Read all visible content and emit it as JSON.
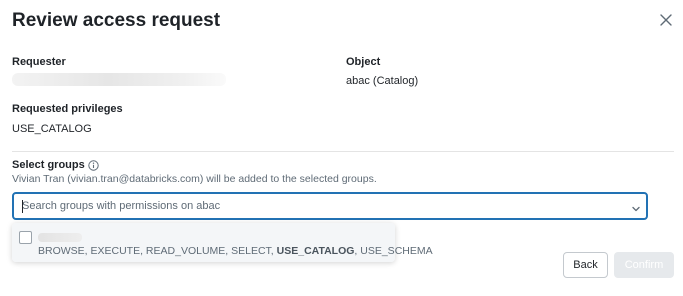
{
  "dialog": {
    "title": "Review access request"
  },
  "requester": {
    "label": "Requester",
    "value": ""
  },
  "object": {
    "label": "Object",
    "value": "abac (Catalog)"
  },
  "privileges": {
    "label": "Requested privileges",
    "value": "USE_CATALOG"
  },
  "groups": {
    "label": "Select groups",
    "description": "Vivian Tran (vivian.tran@databricks.com) will be added to the selected groups.",
    "search_placeholder": "Search groups with permissions on abac",
    "search_value": "",
    "options": [
      {
        "name": "",
        "checked": false,
        "privileges_before": "BROWSE, EXECUTE, READ_VOLUME, SELECT, ",
        "privileges_highlight": "USE_CATALOG",
        "privileges_after": ", USE_SCHEMA"
      }
    ]
  },
  "footer": {
    "back_label": "Back",
    "confirm_label": "Confirm"
  },
  "icons": {
    "close": "close-icon",
    "info": "info-icon",
    "chevron": "chevron-down-icon"
  },
  "colors": {
    "accent": "#2272b4",
    "disabled_button": "#e6e9ec",
    "secondary_text": "#5f6b76"
  }
}
